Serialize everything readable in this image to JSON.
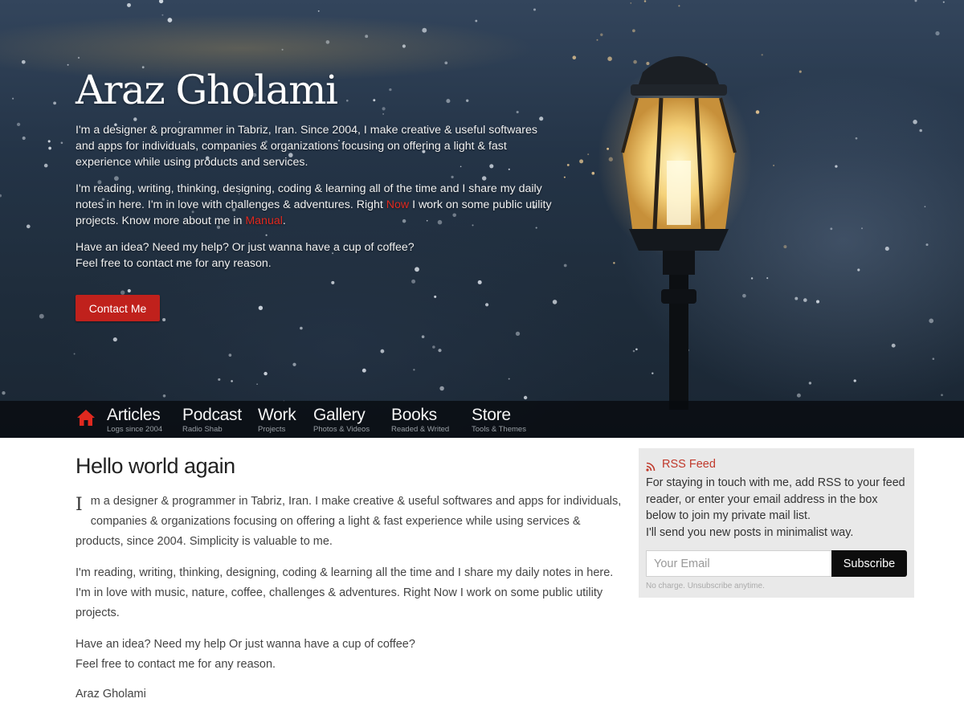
{
  "hero": {
    "title": "Araz Gholami",
    "p1": "I'm a designer & programmer in Tabriz, Iran. Since 2004, I make creative & useful softwares and apps for individuals, companies & organizations focusing on offering a light & fast experience while using products and services.",
    "p2_a": "I'm reading, writing, thinking, designing, coding & learning all of the time and I share my daily notes in here. I'm in love with challenges & adventures. Right ",
    "p2_now": "Now",
    "p2_b": " I work on some public utility projects. Know more about me in ",
    "p2_manual": "Manual",
    "p2_c": ".",
    "p3_line1": "Have an idea? Need my help? Or just wanna have a cup of coffee?",
    "p3_line2": "Feel free to contact me for any reason.",
    "contact_label": "Contact Me",
    "accent_color": "#c0211c"
  },
  "nav": {
    "home_icon": "home-icon",
    "items": [
      {
        "label": "Articles",
        "sub": "Logs since 2004"
      },
      {
        "label": "Podcast",
        "sub": "Radio Shab"
      },
      {
        "label": "Work",
        "sub": "Projects"
      },
      {
        "label": "Gallery",
        "sub": "Photos & Videos"
      },
      {
        "label": "Books",
        "sub": "Readed & Writed"
      },
      {
        "label": "Store",
        "sub": "Tools & Themes"
      }
    ]
  },
  "main": {
    "title": "Hello world again",
    "dropcap": "I",
    "p1": "m a designer & programmer in Tabriz, Iran. I make creative & useful softwares and apps for individuals, companies & organizations focusing on offering a light & fast experience while using services & products, since 2004. Simplicity is valuable to me.",
    "p2": "I'm reading, writing, thinking, designing, coding & learning all the time and I share my daily notes in here. I'm in love with music, nature, coffee, challenges & adventures. Right Now I work on some public utility projects.",
    "p3_line1": "Have an idea? Need my help Or just wanna have a cup of coffee?",
    "p3_line2": "Feel free to contact me for any reason.",
    "signature": "Araz Gholami"
  },
  "sidebar": {
    "rss_icon": "rss-icon",
    "rss_title": "RSS Feed",
    "rss_text_1": "For staying in touch with me, add RSS to your feed reader, or enter your email address in the box below to join my private mail list.",
    "rss_text_2": "I'll send you new posts in minimalist way.",
    "email_placeholder": "Your Email",
    "subscribe_label": "Subscribe",
    "fine_print": "No charge. Unsubscribe anytime."
  }
}
